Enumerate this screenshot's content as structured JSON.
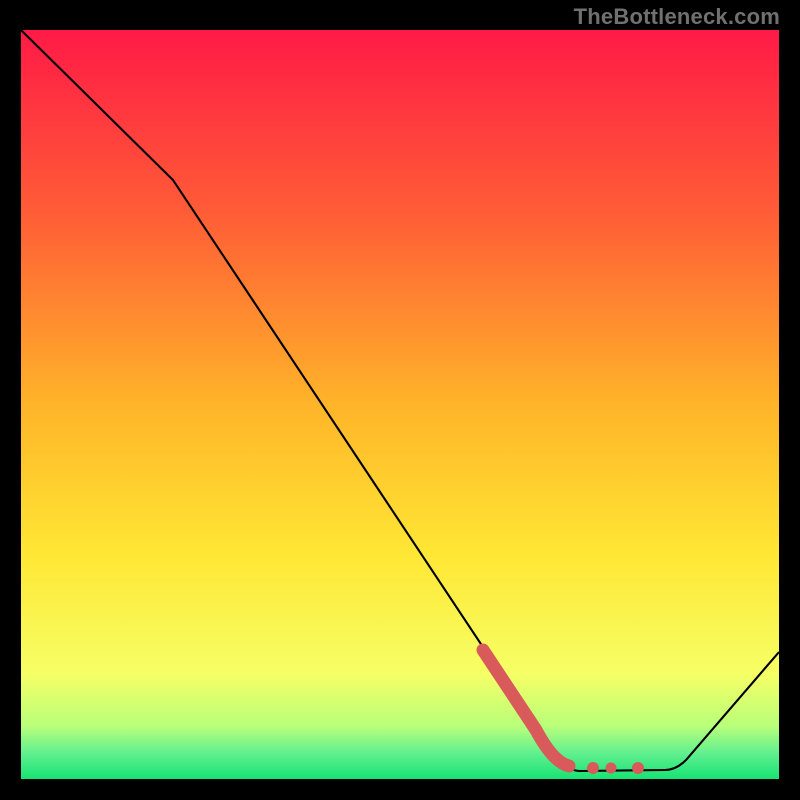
{
  "watermark": "TheBottleneck.com",
  "chart_data": {
    "type": "line",
    "title": "",
    "xlabel": "",
    "ylabel": "",
    "xlim": [
      0,
      100
    ],
    "ylim": [
      0,
      100
    ],
    "series": [
      {
        "name": "curve",
        "x": [
          0,
          20,
          68,
          72,
          80,
          85,
          100
        ],
        "y": [
          100,
          80,
          7,
          1,
          0.5,
          1,
          17
        ]
      }
    ],
    "highlight_segment": {
      "name": "marker-band",
      "x": [
        61,
        68,
        72,
        74,
        76,
        78,
        80
      ],
      "y": [
        17,
        6,
        1.5,
        1.2,
        1.2,
        1.2,
        1.2
      ]
    },
    "background": {
      "type": "vertical-gradient",
      "stops": [
        {
          "pos": 0.0,
          "color": "#ff1a46"
        },
        {
          "pos": 0.25,
          "color": "#ff5e36"
        },
        {
          "pos": 0.5,
          "color": "#ffb429"
        },
        {
          "pos": 0.7,
          "color": "#ffe734"
        },
        {
          "pos": 0.86,
          "color": "#f6ff66"
        },
        {
          "pos": 0.93,
          "color": "#b8ff7a"
        },
        {
          "pos": 0.965,
          "color": "#62f08f"
        },
        {
          "pos": 1.0,
          "color": "#17e374"
        }
      ]
    }
  }
}
